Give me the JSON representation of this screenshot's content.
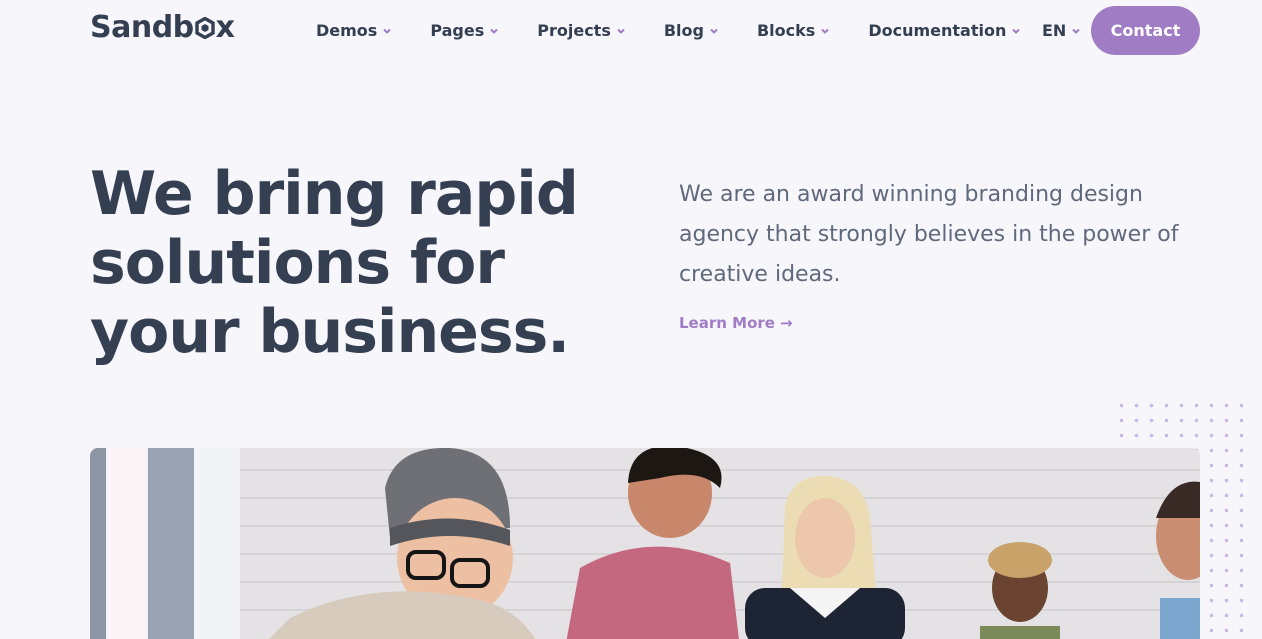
{
  "logo": {
    "text_start": "Sandb",
    "text_end": "x"
  },
  "nav": {
    "items": [
      {
        "label": "Demos"
      },
      {
        "label": "Pages"
      },
      {
        "label": "Projects"
      },
      {
        "label": "Blog"
      },
      {
        "label": "Blocks"
      },
      {
        "label": "Documentation"
      }
    ],
    "language": "EN",
    "contact_label": "Contact"
  },
  "hero": {
    "title_line1": "We bring rapid",
    "title_line2": "solutions for",
    "title_line3": "your business.",
    "description": "We are an award winning branding design agency that strongly believes in the power of creative ideas.",
    "learn_more": "Learn More",
    "learn_more_arrow": "→"
  },
  "icons": {
    "chevron": "chevron-down-icon",
    "arrow": "arrow-right-icon"
  },
  "colors": {
    "accent": "#a07cc5",
    "text_dark": "#343f52",
    "text_muted": "#60697b",
    "background": "#f7f6fb"
  }
}
